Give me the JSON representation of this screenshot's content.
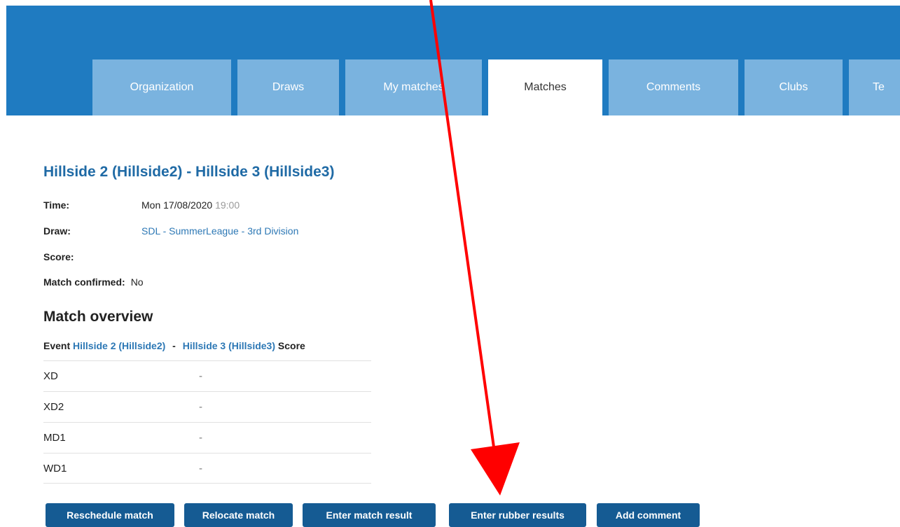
{
  "nav": {
    "tabs": [
      {
        "label": "Organization",
        "active": false
      },
      {
        "label": "Draws",
        "active": false
      },
      {
        "label": "My matches",
        "active": false
      },
      {
        "label": "Matches",
        "active": true
      },
      {
        "label": "Comments",
        "active": false
      },
      {
        "label": "Clubs",
        "active": false
      },
      {
        "label": "Te",
        "active": false
      }
    ]
  },
  "match": {
    "title": "Hillside 2 (Hillside2) - Hillside 3 (Hillside3)",
    "time_label": "Time:",
    "time_date": "Mon 17/08/2020",
    "time_hour": "19:00",
    "draw_label": "Draw:",
    "draw_value": "SDL - SummerLeague - 3rd Division",
    "score_label": "Score:",
    "score_value": "",
    "confirmed_label": "Match confirmed:",
    "confirmed_value": "No"
  },
  "overview": {
    "title": "Match overview",
    "header_event": "Event",
    "header_team1": "Hillside 2 (Hillside2)",
    "header_sep": "-",
    "header_team2": "Hillside 3 (Hillside3)",
    "header_score": "Score",
    "rows": [
      {
        "event": "XD",
        "result": "-"
      },
      {
        "event": "XD2",
        "result": "-"
      },
      {
        "event": "MD1",
        "result": "-"
      },
      {
        "event": "WD1",
        "result": "-"
      }
    ]
  },
  "actions": {
    "reschedule": "Reschedule match",
    "relocate": "Relocate match",
    "enter_match_result": "Enter match result",
    "enter_rubber_results": "Enter rubber results",
    "add_comment": "Add comment"
  },
  "colors": {
    "header_bar": "#1f7bc1",
    "tab_inactive": "#7ab3df",
    "link": "#2d78b5",
    "button": "#155b93",
    "annotation_arrow": "#ff0000"
  }
}
